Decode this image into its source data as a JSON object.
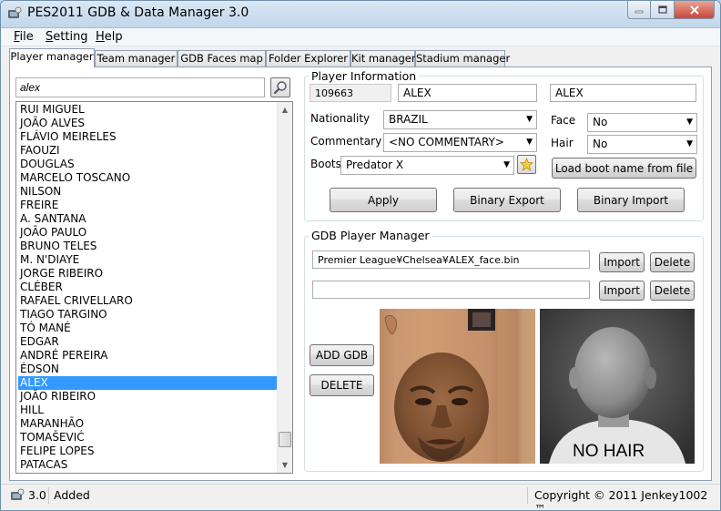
{
  "window": {
    "title": "PES2011 GDB & Data Manager 3.0",
    "min_icon": "minimize-icon",
    "max_icon": "maximize-icon",
    "close_icon": "close-icon"
  },
  "menu": [
    {
      "label_ul": "F",
      "label_rest": "ile"
    },
    {
      "label_ul": "S",
      "label_rest": "etting"
    },
    {
      "label_ul": "H",
      "label_rest": "elp"
    }
  ],
  "tabs": [
    "Player manager",
    "Team manager",
    "GDB Faces map",
    "Folder Explorer",
    "Kit manager",
    "Stadium manager"
  ],
  "search": {
    "value": "alex"
  },
  "players": [
    "RUI MIGUEL",
    "JOÃO ALVES",
    "FLÁVIO MEIRELES",
    "FAOUZI",
    "DOUGLAS",
    "MARCELO TOSCANO",
    "NILSON",
    "FREIRE",
    "A. SANTANA",
    "JOÃO PAULO",
    "BRUNO TELES",
    "M. N'DIAYE",
    "JORGE RIBEIRO",
    "CLÉBER",
    "RAFAEL CRIVELLARO",
    "TIAGO TARGINO",
    "TÓ MANÉ",
    "EDGAR",
    "ANDRÉ PEREIRA",
    "ÉDSON",
    "ALEX",
    "JOÃO RIBEIRO",
    "HILL",
    "MARANHÃO",
    "TOMAŠEVIĆ",
    "FELIPE LOPES",
    "PATACAS"
  ],
  "selected_player": "ALEX",
  "player_info": {
    "title": "Player Information",
    "id": "109663",
    "name": "ALEX",
    "shirt_name": "ALEX",
    "nationality_label": "Nationality",
    "nationality": "BRAZIL",
    "commentary_label": "Commentary",
    "commentary": "<NO COMMENTARY>",
    "boots_label": "Boots",
    "boots": "Predator X",
    "face_label": "Face",
    "face": "No",
    "hair_label": "Hair",
    "hair": "No",
    "load_boot_label": "Load boot name from file",
    "apply_label": "Apply",
    "binary_export_label": "Binary Export",
    "binary_import_label": "Binary Import"
  },
  "gdb": {
    "title": "GDB Player Manager",
    "face_path": "Premier League¥Chelsea¥ALEX_face.bin",
    "hair_path": "",
    "import_label": "Import",
    "delete_label": "Delete",
    "add_gdb_label": "ADD GDB",
    "delete_gdb_label": "DELETE",
    "no_hair_text": "NO HAIR"
  },
  "status": {
    "version": "3.0",
    "message": "Added",
    "copyright": "Copyright © 2011 Jenkey1002 ™"
  }
}
